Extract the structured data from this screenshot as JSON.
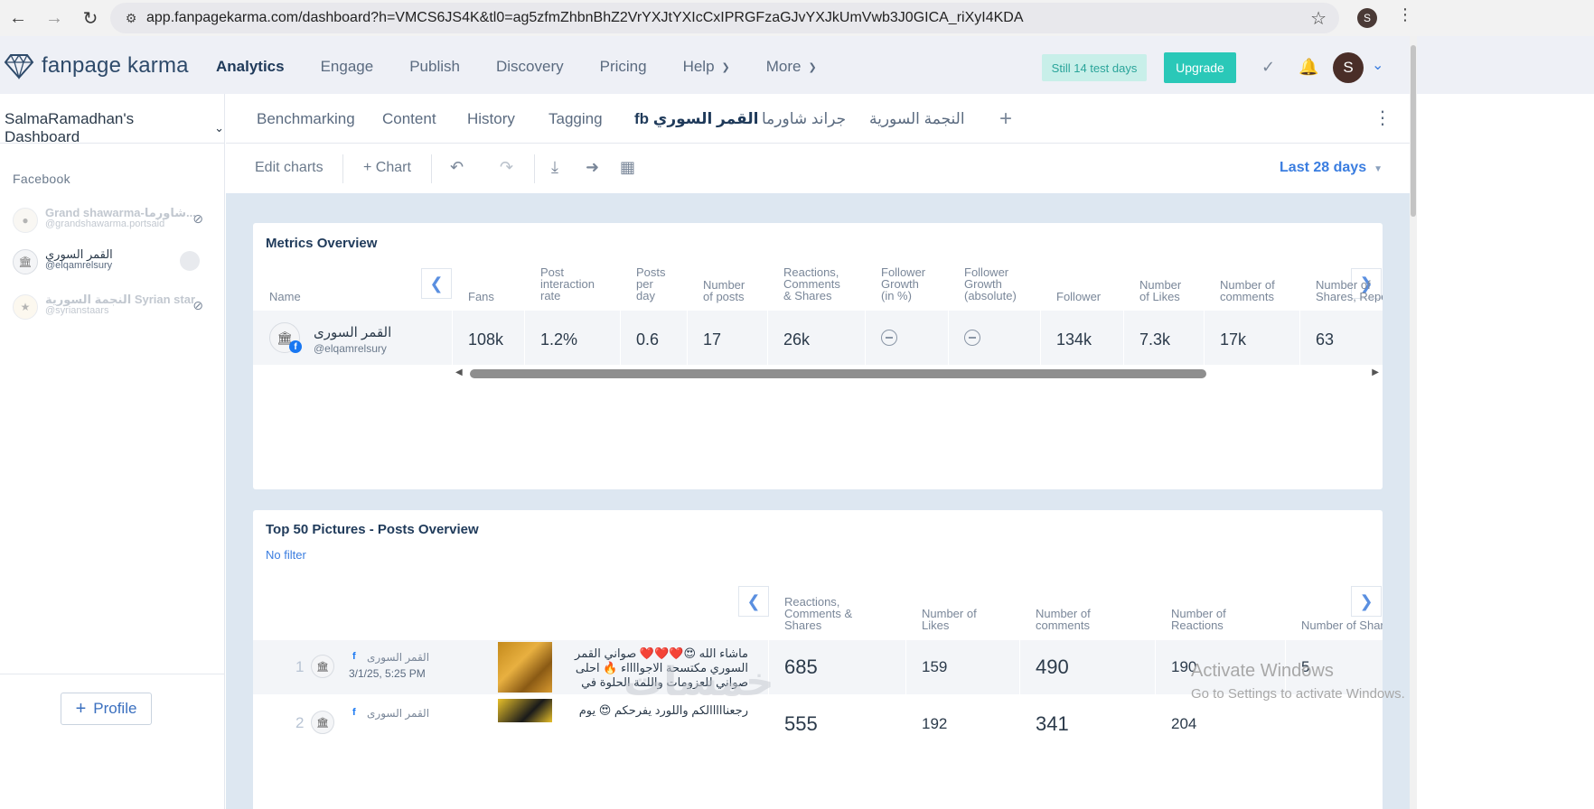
{
  "browser": {
    "url": "app.fanpagekarma.com/dashboard?h=VMCS6JS4K&tl0=ag5zfmZhbnBhZ2VrYXJtYXIcCxIPRGFzaGJvYXJkUmVwb3J0GICA_riXyI4KDA",
    "profile_initial": "S"
  },
  "header": {
    "logo_text": "fanpage karma",
    "nav": [
      {
        "label": "Analytics"
      },
      {
        "label": "Engage"
      },
      {
        "label": "Publish"
      },
      {
        "label": "Discovery"
      },
      {
        "label": "Pricing"
      },
      {
        "label": "Help"
      },
      {
        "label": "More"
      }
    ],
    "trial_badge": "Still 14 test days",
    "upgrade_label": "Upgrade",
    "avatar_initial": "S"
  },
  "sidebar": {
    "dashboard_title": "SalmaRamadhan's Dashboard",
    "network_label": "Facebook",
    "profiles": [
      {
        "name": "Grand shawarma-شاورما...",
        "handle": "@grandshawarma.portsaid"
      },
      {
        "name": "القمر السوري",
        "handle": "@elqamrelsury"
      },
      {
        "name": "النجمة السورية Syrian star",
        "handle": "@syrianstaars"
      }
    ],
    "profile_button": "Profile"
  },
  "tabs": [
    "Benchmarking",
    "Content",
    "History",
    "Tagging",
    "القمر السوري fb",
    "جراند شاورما",
    "النجمة السورية"
  ],
  "toolbar": {
    "edit_charts": "Edit charts",
    "add_chart": "+ Chart",
    "period": "Last 28 days"
  },
  "metrics": {
    "title": "Metrics Overview",
    "name_header": "Name",
    "columns": [
      [
        "Fans"
      ],
      [
        "Post",
        "interaction",
        "rate"
      ],
      [
        "Posts",
        "per",
        "day"
      ],
      [
        "Number",
        "of posts"
      ],
      [
        "Reactions,",
        "Comments",
        "& Shares"
      ],
      [
        "Follower",
        "Growth",
        "(in %)"
      ],
      [
        "Follower",
        "Growth",
        "(absolute)"
      ],
      [
        "Follower"
      ],
      [
        "Number",
        "of Likes"
      ],
      [
        "Number of",
        "comments"
      ],
      [
        "Number of",
        "Shares, Reposts"
      ]
    ],
    "row": {
      "name": "القمر السورى",
      "handle": "@elqamrelsury",
      "values": [
        "108k",
        "1.2%",
        "0.6",
        "17",
        "26k",
        "",
        "",
        "134k",
        "7.3k",
        "17k",
        "63"
      ]
    }
  },
  "posts": {
    "title": "Top 50 Pictures - Posts Overview",
    "filter": "No filter",
    "columns": [
      [
        "Reactions,",
        "Comments &",
        "Shares"
      ],
      [
        "Number of",
        "Likes"
      ],
      [
        "Number of",
        "comments"
      ],
      [
        "Number of",
        "Reactions"
      ],
      [
        "Number of Shares"
      ]
    ],
    "rows": [
      {
        "rank": "1",
        "page": "القمر السورى",
        "date": "3/1/25, 5:25 PM",
        "text": "ماشاء الله 😍❤️❤️❤️ صواني القمر السوري مكتسحة الاجوااااء 🔥 احلى صواني للعزومات واللمة الحلوة في",
        "values": [
          "685",
          "159",
          "490",
          "190",
          "5"
        ]
      },
      {
        "rank": "2",
        "page": "القمر السورى",
        "date": "",
        "text": "رجعنااااالكم واللورد يفرحكم 😍 يوم",
        "values": [
          "555",
          "192",
          "341",
          "204",
          ""
        ]
      }
    ]
  },
  "overlay": {
    "activate_title": "Activate Windows",
    "activate_sub": "Go to Settings to activate Windows.",
    "watermark": "خمسات"
  },
  "colors": {
    "accent": "#3a7de0",
    "upgrade": "#2ac8b8",
    "trial_bg": "#c8efe9",
    "content_bg": "#dde7f1"
  }
}
